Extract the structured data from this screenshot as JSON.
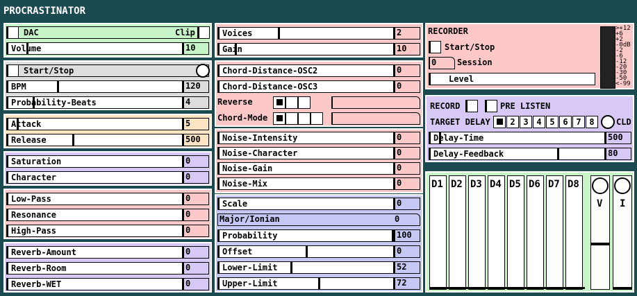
{
  "app": {
    "title": "PROCRASTINATOR"
  },
  "colors": {
    "background": "#1b4b50",
    "green": "#c8f5c8",
    "gray": "#dddddd",
    "peach": "#fde5c4",
    "lavender": "#d7c8f5",
    "pink": "#fcc8c8",
    "periwinkle": "#c5c8f3"
  },
  "left": {
    "dac": {
      "label": "DAC",
      "clip_label": "Clip"
    },
    "volume": {
      "label": "Volume",
      "value": "10"
    },
    "start_stop": {
      "label": "Start/Stop"
    },
    "bpm": {
      "label": "BPM",
      "value": "120"
    },
    "prob_beats": {
      "label": "Probability-Beats",
      "value": "4"
    },
    "attack": {
      "label": "Attack",
      "value": "5"
    },
    "release": {
      "label": "Release",
      "value": "500"
    },
    "saturation": {
      "label": "Saturation",
      "value": "0"
    },
    "character": {
      "label": "Character",
      "value": "0"
    },
    "low_pass": {
      "label": "Low-Pass",
      "value": "0"
    },
    "resonance": {
      "label": "Resonance",
      "value": "0"
    },
    "high_pass": {
      "label": "High-Pass",
      "value": "0"
    },
    "reverb_amount": {
      "label": "Reverb-Amount",
      "value": "0"
    },
    "reverb_room": {
      "label": "Reverb-Room",
      "value": "0"
    },
    "reverb_wet": {
      "label": "Reverb-WET",
      "value": "0"
    }
  },
  "middle": {
    "voices": {
      "label": "Voices",
      "value": "2"
    },
    "gain": {
      "label": "Gain",
      "value": "10"
    },
    "chord_osc2": {
      "label": "Chord-Distance-OSC2",
      "value": "0"
    },
    "chord_osc3": {
      "label": "Chord-Distance-OSC3",
      "value": "0"
    },
    "reverse": {
      "label": "Reverse"
    },
    "chord_mode": {
      "label": "Chord-Mode"
    },
    "noise_intensity": {
      "label": "Noise-Intensity",
      "value": "0"
    },
    "noise_character": {
      "label": "Noise-Character",
      "value": "0"
    },
    "noise_gain": {
      "label": "Noise-Gain",
      "value": "0"
    },
    "noise_mix": {
      "label": "Noise-Mix",
      "value": "0"
    },
    "scale": {
      "label": "Scale",
      "value": "0"
    },
    "major_ionian": {
      "label": "Major/Ionian",
      "value": "0"
    },
    "probability": {
      "label": "Probability",
      "value": "100"
    },
    "offset": {
      "label": "Offset",
      "value": "0"
    },
    "lower_limit": {
      "label": "Lower-Limit",
      "value": "52"
    },
    "upper_limit": {
      "label": "Upper-Limit",
      "value": "72"
    }
  },
  "recorder": {
    "title": "RECORDER",
    "start_stop": "Start/Stop",
    "session_value": "0",
    "session_label": "Session",
    "level_label": "Level",
    "meter_labels": [
      ">+12",
      "+6",
      "+2",
      "-0dB",
      "-2",
      "-6",
      "-12",
      "-20",
      "-30",
      "-50",
      "<-99"
    ]
  },
  "delay": {
    "record_label": "RECORD",
    "pre_listen_label": "PRE LISTEN",
    "target_label": "TARGET DELAY",
    "targets": [
      "1",
      "2",
      "3",
      "4",
      "5",
      "6",
      "7",
      "8"
    ],
    "cld_label": "CLD",
    "delay_time": {
      "label": "Delay-Time",
      "value": "500"
    },
    "delay_feedback": {
      "label": "Delay-Feedback",
      "value": "80"
    }
  },
  "mixer": {
    "channels": [
      "D1",
      "D2",
      "D3",
      "D4",
      "D5",
      "D6",
      "D7",
      "D8"
    ],
    "v_label": "V",
    "i_label": "I"
  }
}
